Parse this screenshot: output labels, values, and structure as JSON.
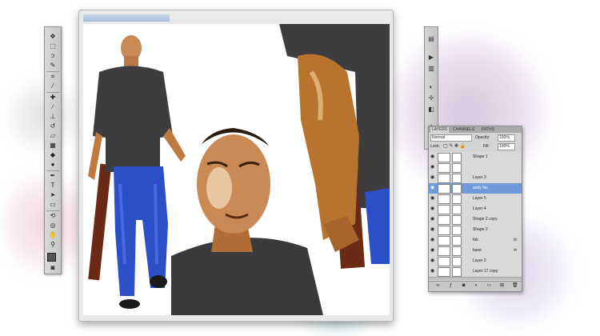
{
  "layers_panel": {
    "tabs": [
      "LAYERS",
      "CHANNELS",
      "PATHS"
    ],
    "blend_mode": "Normal",
    "opacity_label": "Opacity:",
    "opacity_value": "100%",
    "fill_label": "Fill:",
    "fill_value": "100%",
    "lock_label": "Lock:",
    "layers": [
      {
        "name": "Shape 1",
        "fx": false,
        "selected": false
      },
      {
        "name": "",
        "fx": false,
        "selected": false
      },
      {
        "name": "Layer 3",
        "fx": false,
        "selected": false
      },
      {
        "name": "andy fac",
        "fx": false,
        "selected": true
      },
      {
        "name": "Layer 5",
        "fx": false,
        "selected": false
      },
      {
        "name": "Layer 4",
        "fx": false,
        "selected": false
      },
      {
        "name": "Shape 2 copy",
        "fx": false,
        "selected": false
      },
      {
        "name": "Shape 2",
        "fx": false,
        "selected": false
      },
      {
        "name": "fab",
        "fx": true,
        "selected": false
      },
      {
        "name": "base",
        "fx": true,
        "selected": false
      },
      {
        "name": "Layer 2",
        "fx": false,
        "selected": false
      },
      {
        "name": "Layer 17 copy",
        "fx": false,
        "selected": false
      }
    ],
    "fx_label": "fx"
  },
  "icons": {
    "eye": "eye-icon",
    "tools": [
      "move-tool-icon",
      "marquee-tool-icon",
      "lasso-tool-icon",
      "quick-select-icon",
      "crop-tool-icon",
      "eyedropper-icon",
      "healing-brush-icon",
      "brush-tool-icon",
      "clone-stamp-icon",
      "history-brush-icon",
      "eraser-icon",
      "gradient-icon",
      "blur-icon",
      "dodge-icon",
      "pen-tool-icon",
      "type-tool-icon",
      "path-select-icon",
      "shape-tool-icon",
      "3d-rotate-icon",
      "3d-orbit-icon",
      "hand-tool-icon",
      "zoom-tool-icon",
      "foreground-color-icon",
      "quick-mask-icon"
    ]
  },
  "colors": {
    "selected_layer": "#6f99d9",
    "panel_bg": "#d4d4d4",
    "jeans": "#2b4fc7",
    "tshirt": "#3d3c3f",
    "skin": "#c07a3f"
  }
}
